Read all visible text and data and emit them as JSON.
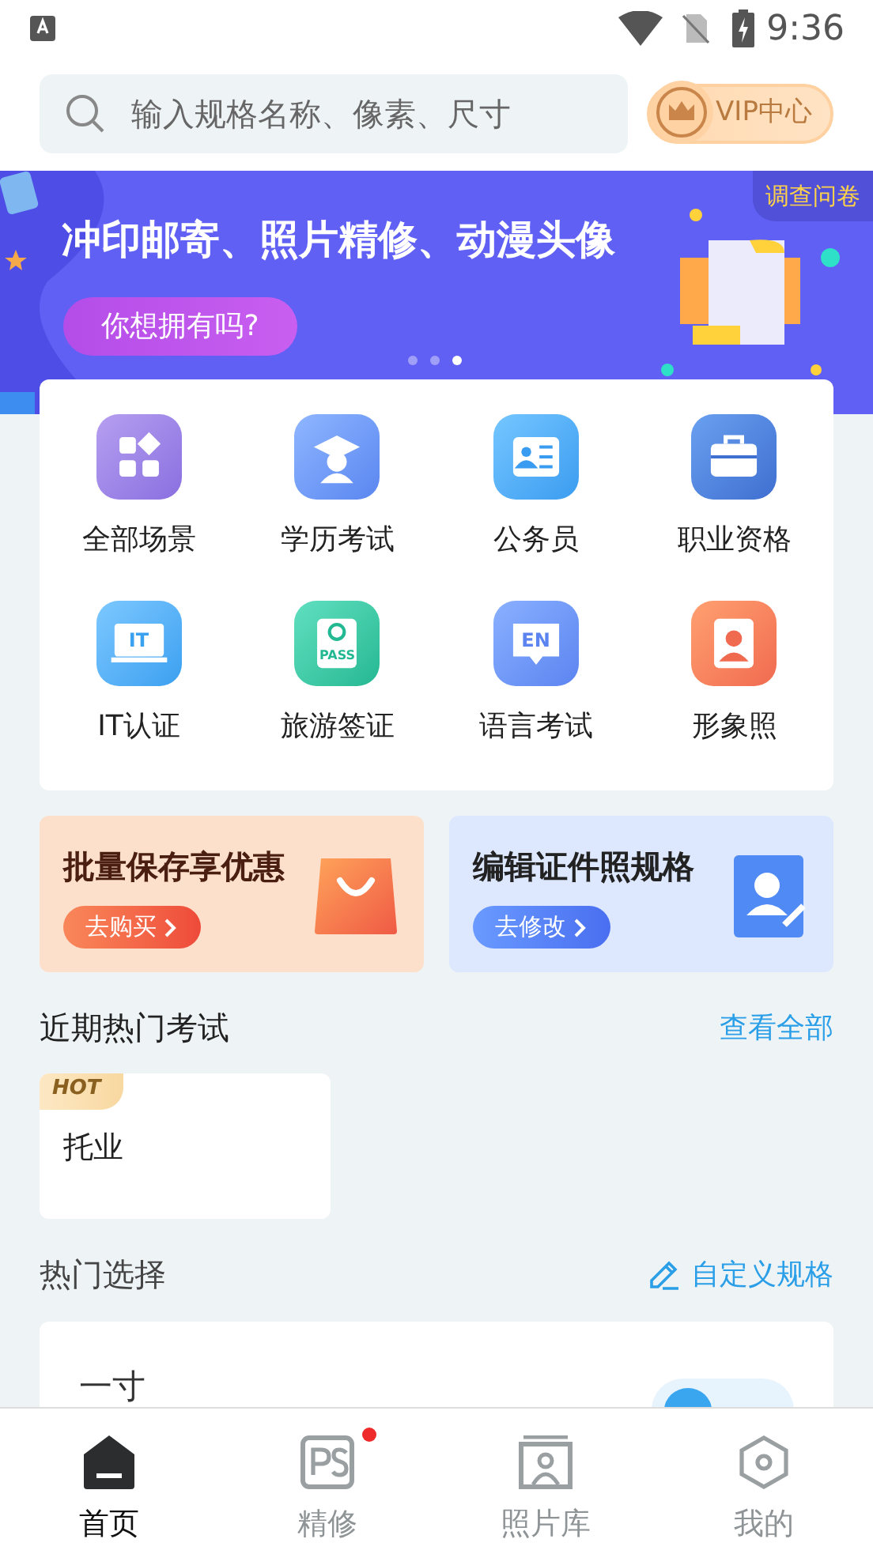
{
  "status_bar": {
    "time": "9:36"
  },
  "search": {
    "placeholder": "输入规格名称、像素、尺寸"
  },
  "vip_button": {
    "label": "VIP中心"
  },
  "banner": {
    "title": "冲印邮寄、照片精修、动漫头像",
    "button": "你想拥有吗?",
    "corner_tag": "调查问卷",
    "dots": [
      {
        "selected": false
      },
      {
        "selected": false
      },
      {
        "selected": true
      }
    ]
  },
  "categories": [
    {
      "label": "全部场景"
    },
    {
      "label": "学历考试"
    },
    {
      "label": "公务员"
    },
    {
      "label": "职业资格"
    },
    {
      "label": "IT认证",
      "icon_text": "IT"
    },
    {
      "label": "旅游签证",
      "icon_text": "PASS"
    },
    {
      "label": "语言考试",
      "icon_text": "EN"
    },
    {
      "label": "形象照"
    }
  ],
  "promos": [
    {
      "kind": "warm",
      "title": "批量保存享优惠",
      "button": "去购买"
    },
    {
      "kind": "cool",
      "title": "编辑证件照规格",
      "button": "去修改"
    }
  ],
  "recent_exams": {
    "title": "近期热门考试",
    "link": "查看全部",
    "items": [
      {
        "badge": "HOT",
        "name": "托业"
      }
    ]
  },
  "hot_picks": {
    "title": "热门选择",
    "link": "自定义规格",
    "items": [
      {
        "name": "一寸"
      }
    ]
  },
  "tab_bar": [
    {
      "label": "首页",
      "selected": true,
      "dot": false
    },
    {
      "label": "精修",
      "selected": false,
      "dot": true
    },
    {
      "label": "照片库",
      "selected": false,
      "dot": false
    },
    {
      "label": "我的",
      "selected": false,
      "dot": false
    }
  ]
}
